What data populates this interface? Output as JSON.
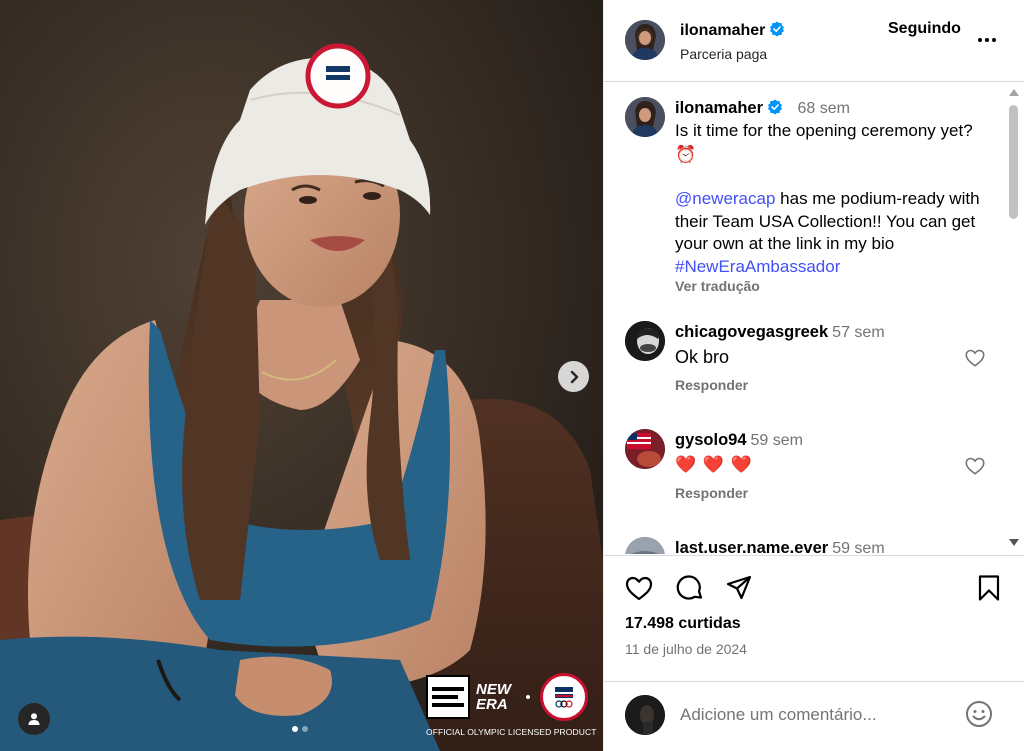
{
  "post": {
    "author": "ilonamaher",
    "author_subtitle": "Parceria paga",
    "follow_label": "Seguindo",
    "carousel": {
      "current": 1,
      "total": 2
    },
    "media_footer": {
      "brand_line1": "NEW",
      "brand_line2": "ERA",
      "licensed_text": "OFFICIAL OLYMPIC LICENSED PRODUCT"
    }
  },
  "caption": {
    "username": "ilonamaher",
    "time": "68 sem",
    "line1": "Is it time for the opening ceremony yet?",
    "emoji": "⏰",
    "mention": "@neweracap",
    "text_after_mention": " has me podium-ready with their Team USA Collection!! You can get your own at the link in my bio",
    "hashtag": "#NewEraAmbassador",
    "see_translation": "Ver tradução"
  },
  "comments": [
    {
      "username": "chicagovegasgreek",
      "time": "57 sem",
      "text": "Ok bro",
      "reply_label": "Responder"
    },
    {
      "username": "gysolo94",
      "time": "59 sem",
      "text": "❤️ ❤️ ❤️",
      "reply_label": "Responder"
    },
    {
      "username": "last.user.name.ever",
      "time": "59 sem"
    }
  ],
  "stats": {
    "likes": "17.498 curtidas",
    "date": "11 de julho de 2024"
  },
  "add_comment": {
    "placeholder": "Adicione um comentário..."
  },
  "icons": {
    "like": "heart-icon",
    "comment": "comment-icon",
    "share": "share-icon",
    "save": "bookmark-icon",
    "emoji": "emoji-icon",
    "next": "chevron-right-icon",
    "tagged_users": "user-tag-icon",
    "more": "more-options-icon",
    "verified": "verified-badge-icon"
  },
  "colors": {
    "link": "#4150f7",
    "verified": "#0095f6",
    "heart_emoji": "#e8345a",
    "secondary_text": "#737373"
  }
}
